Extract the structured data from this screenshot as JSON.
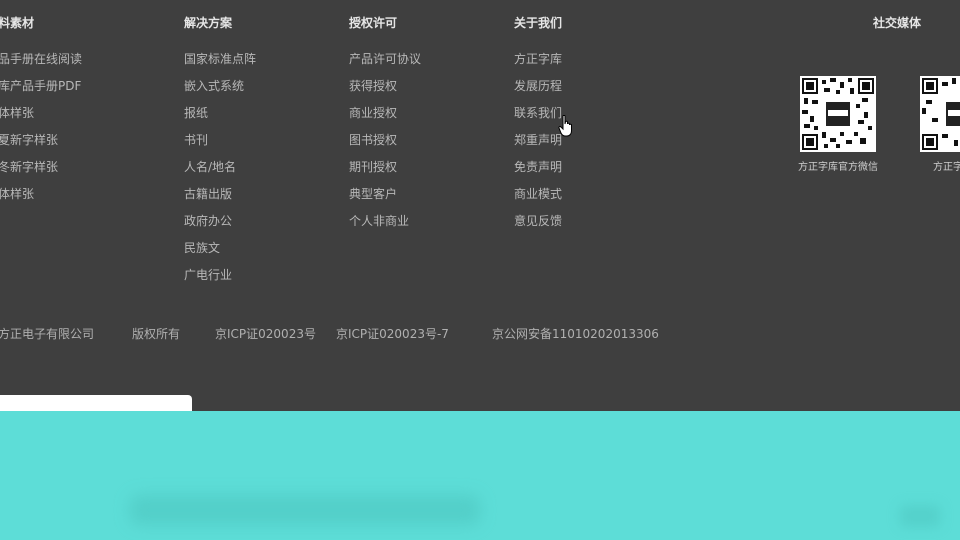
{
  "footer": {
    "columns": [
      {
        "title": "资料素材",
        "items": [
          "产品手册在线阅读",
          "字库产品手册PDF",
          "字体样张",
          "春夏新字样张",
          "秋冬新字样张",
          "字体样张"
        ]
      },
      {
        "title": "解决方案",
        "items": [
          "国家标准点阵",
          "嵌入式系统",
          "报纸",
          "书刊",
          "人名/地名",
          "古籍出版",
          "政府办公",
          "民族文",
          "广电行业"
        ]
      },
      {
        "title": "授权许可",
        "items": [
          "产品许可协议",
          "获得授权",
          "商业授权",
          "图书授权",
          "期刊授权",
          "典型客户",
          "个人非商业"
        ]
      },
      {
        "title": "关于我们",
        "items": [
          "方正字库",
          "发展历程",
          "联系我们",
          "郑重声明",
          "免责声明",
          "商业模式",
          "意见反馈"
        ]
      }
    ],
    "social": {
      "title": "社交媒体",
      "qr_codes": [
        {
          "label": "方正字库官方微信",
          "icon": "wechat-qr-icon"
        },
        {
          "label": "方正字库官",
          "icon": "weibo-qr-icon"
        }
      ]
    },
    "bottom": {
      "company": "方正电子有限公司",
      "rights": "版权所有",
      "icp1": "京ICP证020023号",
      "icp2": "京ICP证020023号-7",
      "police": "京公网安备11010202013306"
    }
  },
  "colors": {
    "footer_bg": "#3f3f3f",
    "teal_band": "#5dddd7"
  }
}
